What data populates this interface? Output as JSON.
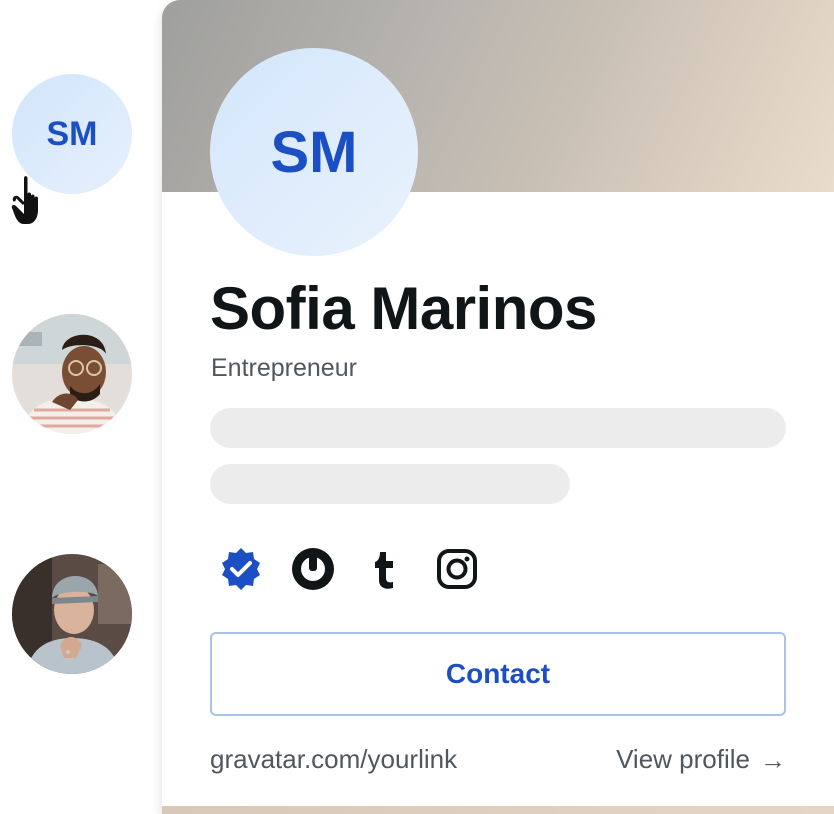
{
  "sidebar": {
    "avatars": [
      {
        "type": "initials",
        "initials": "SM"
      },
      {
        "type": "photo"
      },
      {
        "type": "photo"
      }
    ]
  },
  "card": {
    "initials": "SM",
    "name": "Sofia Marinos",
    "title": "Entrepreneur",
    "social_icons": [
      "verified-badge-icon",
      "gravatar-icon",
      "tumblr-icon",
      "instagram-icon"
    ],
    "contact_label": "Contact",
    "profile_link": "gravatar.com/yourlink",
    "view_profile_label": "View profile",
    "view_profile_arrow": "→"
  },
  "colors": {
    "accent": "#1d4fc4",
    "avatar_bg": "#d4e6fb",
    "name_text": "#101517",
    "muted_text": "#50575e",
    "skeleton": "#ececec",
    "contact_border": "#a9c2ea"
  }
}
